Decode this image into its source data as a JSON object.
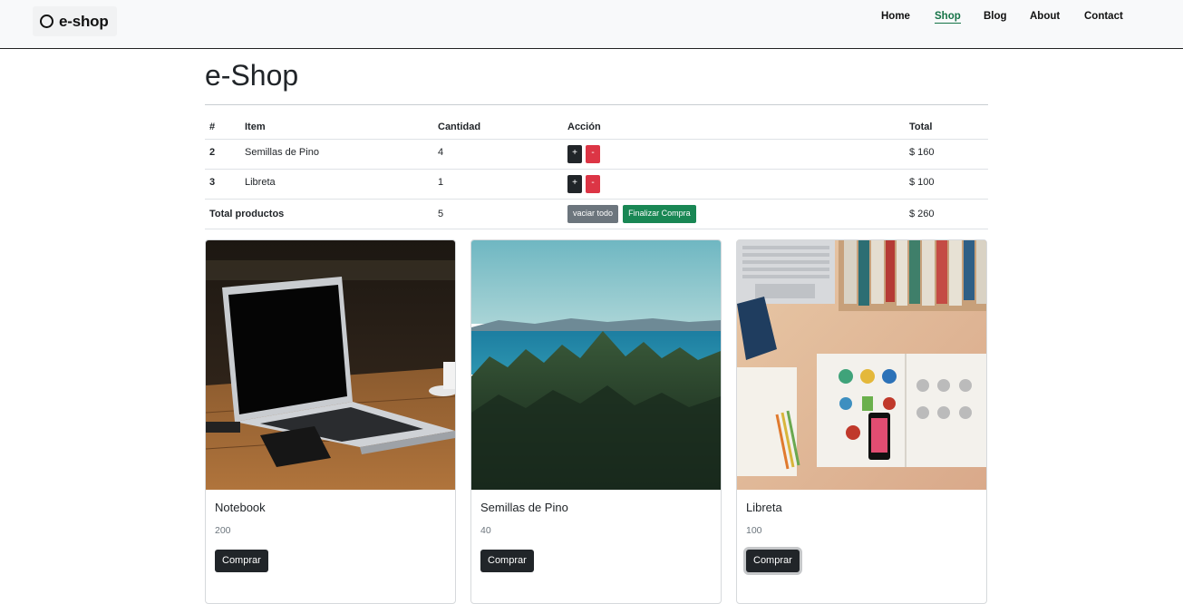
{
  "navbar": {
    "brand": "e-shop",
    "links": [
      {
        "label": "Home",
        "active": false
      },
      {
        "label": "Shop",
        "active": true
      },
      {
        "label": "Blog",
        "active": false
      },
      {
        "label": "About",
        "active": false
      },
      {
        "label": "Contact",
        "active": false
      }
    ]
  },
  "page": {
    "title": "e-Shop"
  },
  "cart": {
    "headers": {
      "num": "#",
      "item": "Item",
      "qty": "Cantidad",
      "action": "Acción",
      "total": "Total"
    },
    "rows": [
      {
        "num": "2",
        "item": "Semillas de Pino",
        "qty": "4",
        "plus": "+",
        "minus": "-",
        "total": "$ 160"
      },
      {
        "num": "3",
        "item": "Libreta",
        "qty": "1",
        "plus": "+",
        "minus": "-",
        "total": "$ 100"
      }
    ],
    "footer": {
      "label": "Total productos",
      "qty": "5",
      "clear_label": "vaciar todo",
      "checkout_label": "Finalizar Compra",
      "total": "$ 260"
    }
  },
  "products": [
    {
      "title": "Notebook",
      "price": "200",
      "button": "Comprar",
      "image": "laptop-photo"
    },
    {
      "title": "Semillas de Pino",
      "price": "40",
      "button": "Comprar",
      "image": "pine-forest-photo"
    },
    {
      "title": "Libreta",
      "price": "100",
      "button": "Comprar",
      "image": "notebook-desk-photo"
    }
  ],
  "colors": {
    "navbar_bg": "#f8f9fa",
    "active_link": "#157347",
    "dark_button": "#212529",
    "danger_button": "#dc3545",
    "secondary_button": "#6c757d",
    "success_button": "#198754"
  }
}
